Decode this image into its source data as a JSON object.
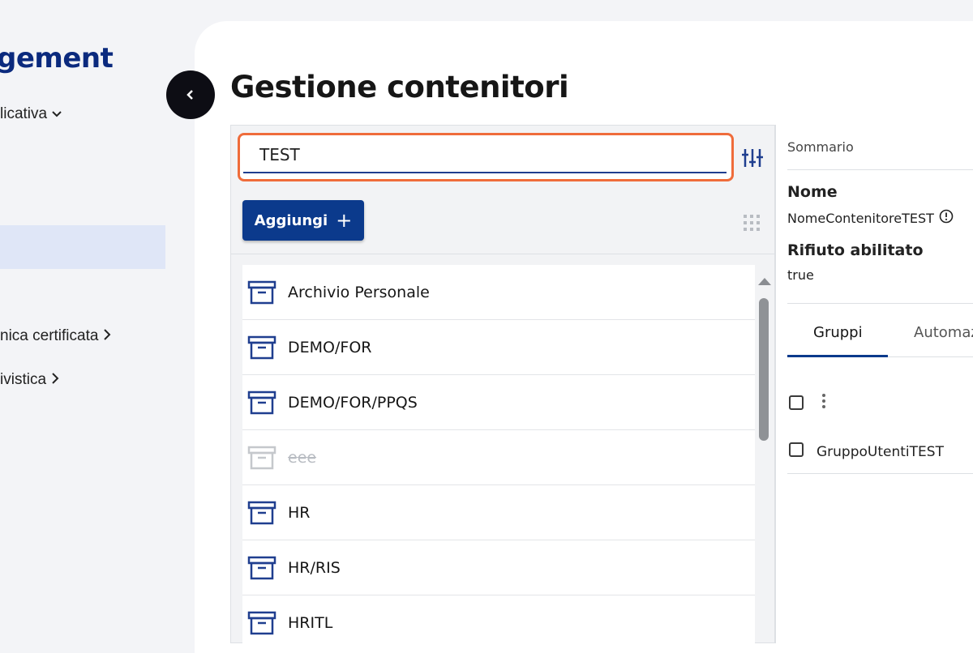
{
  "sidebar": {
    "brand": "gement",
    "items": [
      {
        "label": "licativa",
        "chevron": "chevron-down-icon"
      },
      {
        "label": "nica certificata",
        "chevron": "chevron-right-icon"
      },
      {
        "label": "ivistica",
        "chevron": "chevron-right-icon"
      }
    ],
    "collapse_icon": "chevron-left-icon"
  },
  "main": {
    "title": "Gestione contenitori"
  },
  "search": {
    "value": "TEST",
    "placeholder": ""
  },
  "toolbar": {
    "add_label": "Aggiungi",
    "add_icon": "plus-icon",
    "filter_icon": "sliders-icon",
    "view_icon": "grid-icon"
  },
  "containers": [
    {
      "name": "Archivio Personale",
      "enabled": true
    },
    {
      "name": "DEMO/FOR",
      "enabled": true
    },
    {
      "name": "DEMO/FOR/PPQS",
      "enabled": true
    },
    {
      "name": "eee",
      "enabled": false
    },
    {
      "name": "HR",
      "enabled": true
    },
    {
      "name": "HR/RIS",
      "enabled": true
    },
    {
      "name": "HRITL",
      "enabled": true
    }
  ],
  "detail": {
    "summary_label": "Sommario",
    "name_label": "Nome",
    "name_value": "NomeContenitoreTEST",
    "waste_label": "Rifiuto abilitato",
    "waste_value": "true",
    "tabs": [
      "Gruppi",
      "Automaz"
    ],
    "groups": [
      "GruppoUtentiTEST"
    ]
  },
  "colors": {
    "accent": "#0b3a8c",
    "focus_ring": "#ef6c3b",
    "brand": "#0b2a7e"
  }
}
